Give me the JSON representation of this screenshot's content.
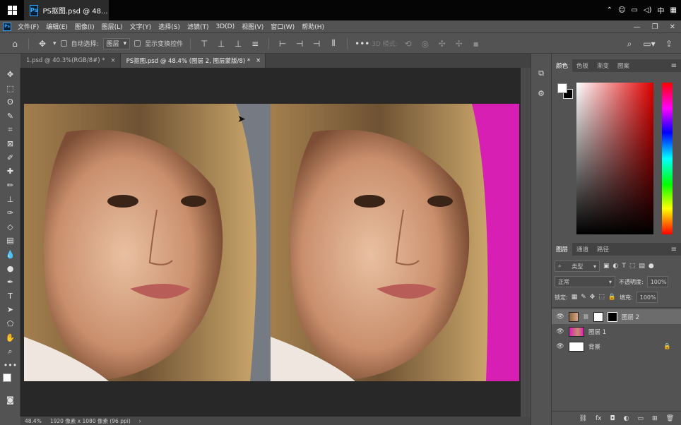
{
  "titlebar": {
    "tab_title": "PS抠图.psd @ 48...",
    "tray_time": "中",
    "ps_logo": "Ps"
  },
  "menubar": {
    "items": [
      "文件(F)",
      "编辑(E)",
      "图像(I)",
      "图层(L)",
      "文字(Y)",
      "选择(S)",
      "滤镜(T)",
      "3D(D)",
      "视图(V)",
      "窗口(W)",
      "帮助(H)"
    ]
  },
  "optionsbar": {
    "auto_select_label": "自动选择:",
    "auto_select_value": "图层",
    "show_transform_label": "显示变换控件",
    "mode_3d_label": "3D 模式:"
  },
  "doctabs": [
    {
      "label": "1.psd @ 40.3%(RGB/8#) *",
      "active": false
    },
    {
      "label": "PS抠图.psd @ 48.4% (图层 2, 图层蒙版/8) *",
      "active": true
    }
  ],
  "statusbar": {
    "zoom": "48.4%",
    "doc_info": "1920 像素 x 1080 像素 (96 ppi)"
  },
  "color_panel": {
    "tabs": [
      "颜色",
      "色板",
      "渐变",
      "图案"
    ],
    "active_tab": 0,
    "fg_color": "#ffffff",
    "bg_color": "#000000",
    "hue_color": "#e00000"
  },
  "layers_panel": {
    "tabs": [
      "图层",
      "通道",
      "路径"
    ],
    "filter_label": "类型",
    "blend_mode": "正常",
    "opacity_label": "不透明度:",
    "opacity_value": "100%",
    "lock_label": "锁定:",
    "fill_label": "填充:",
    "fill_value": "100%",
    "layers": [
      {
        "name": "图层 2",
        "selected": true,
        "has_mask": true
      },
      {
        "name": "图层 1",
        "selected": false,
        "has_mask": false
      },
      {
        "name": "背景",
        "selected": false,
        "locked": true
      }
    ]
  },
  "canvas": {
    "left_bg_color": "#737780",
    "right_bg_color": "#d81fb4"
  }
}
